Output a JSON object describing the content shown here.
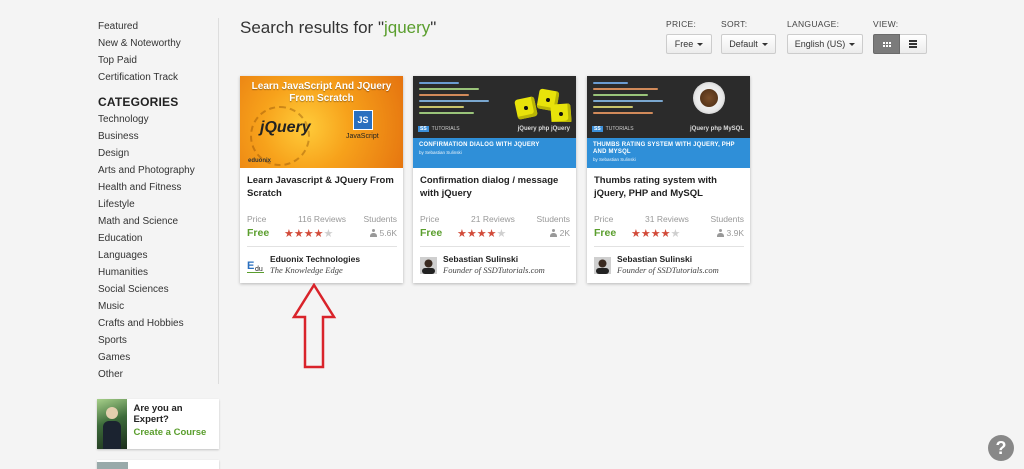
{
  "sidebar": {
    "top_links": [
      "Featured",
      "New & Noteworthy",
      "Top Paid",
      "Certification Track"
    ],
    "categories_heading": "CATEGORIES",
    "categories": [
      "Technology",
      "Business",
      "Design",
      "Arts and Photography",
      "Health and Fitness",
      "Lifestyle",
      "Math and Science",
      "Education",
      "Languages",
      "Humanities",
      "Social Sciences",
      "Music",
      "Crafts and Hobbies",
      "Sports",
      "Games",
      "Other"
    ],
    "promo": {
      "question": "Are you an Expert?",
      "cta": "Create a Course"
    }
  },
  "header": {
    "title_prefix": "Search results for \"",
    "query": "jquery",
    "title_suffix": "\""
  },
  "filters": {
    "price": {
      "label": "PRICE:",
      "value": "Free"
    },
    "sort": {
      "label": "SORT:",
      "value": "Default"
    },
    "language": {
      "label": "LANGUAGE:",
      "value": "English (US)"
    },
    "view": {
      "label": "VIEW:",
      "active": "grid"
    }
  },
  "card_labels": {
    "price": "Price",
    "students": "Students"
  },
  "courses": [
    {
      "title": "Learn Javascript & JQuery From Scratch",
      "reviews": "116 Reviews",
      "price": "Free",
      "rating": 4.5,
      "students": "5.6K",
      "author": "Eduonix Technologies",
      "author_sub": "The Knowledge Edge",
      "thumb": {
        "heading": "Learn JavaScript And JQuery From Scratch",
        "logo": "jQuery",
        "badge": "JS",
        "badge_text": "JavaScript",
        "brand": "eduonix"
      }
    },
    {
      "title": "Confirmation dialog / message with jQuery",
      "reviews": "21 Reviews",
      "price": "Free",
      "rating": 4.5,
      "students": "2K",
      "author": "Sebastian Sulinski",
      "author_sub": "Founder of SSDTutorials.com",
      "thumb": {
        "tag_badge": "SS",
        "tag": "TUTORIALS",
        "logos": "jQuery  php  jQuery",
        "band_title": "CONFIRMATION DIALOG WITH JQUERY",
        "band_sub": "by Sebastian Sulinski"
      }
    },
    {
      "title": "Thumbs rating system with jQuery, PHP and MySQL",
      "reviews": "31 Reviews",
      "price": "Free",
      "rating": 4,
      "students": "3.9K",
      "author": "Sebastian Sulinski",
      "author_sub": "Founder of SSDTutorials.com",
      "thumb": {
        "tag_badge": "SS",
        "tag": "TUTORIALS",
        "logos": "jQuery  php  MySQL",
        "band_title": "THUMBS RATING SYSTEM WITH JQUERY, PHP AND MYSQL",
        "band_sub": "by Sebastian Sulinski"
      }
    }
  ],
  "help": {
    "label": "?"
  },
  "colors": {
    "accent_green": "#5a9e2d",
    "star_red": "#d24b3a",
    "annotation_red": "#d9232a",
    "thumb_blue": "#2f8fd8"
  }
}
